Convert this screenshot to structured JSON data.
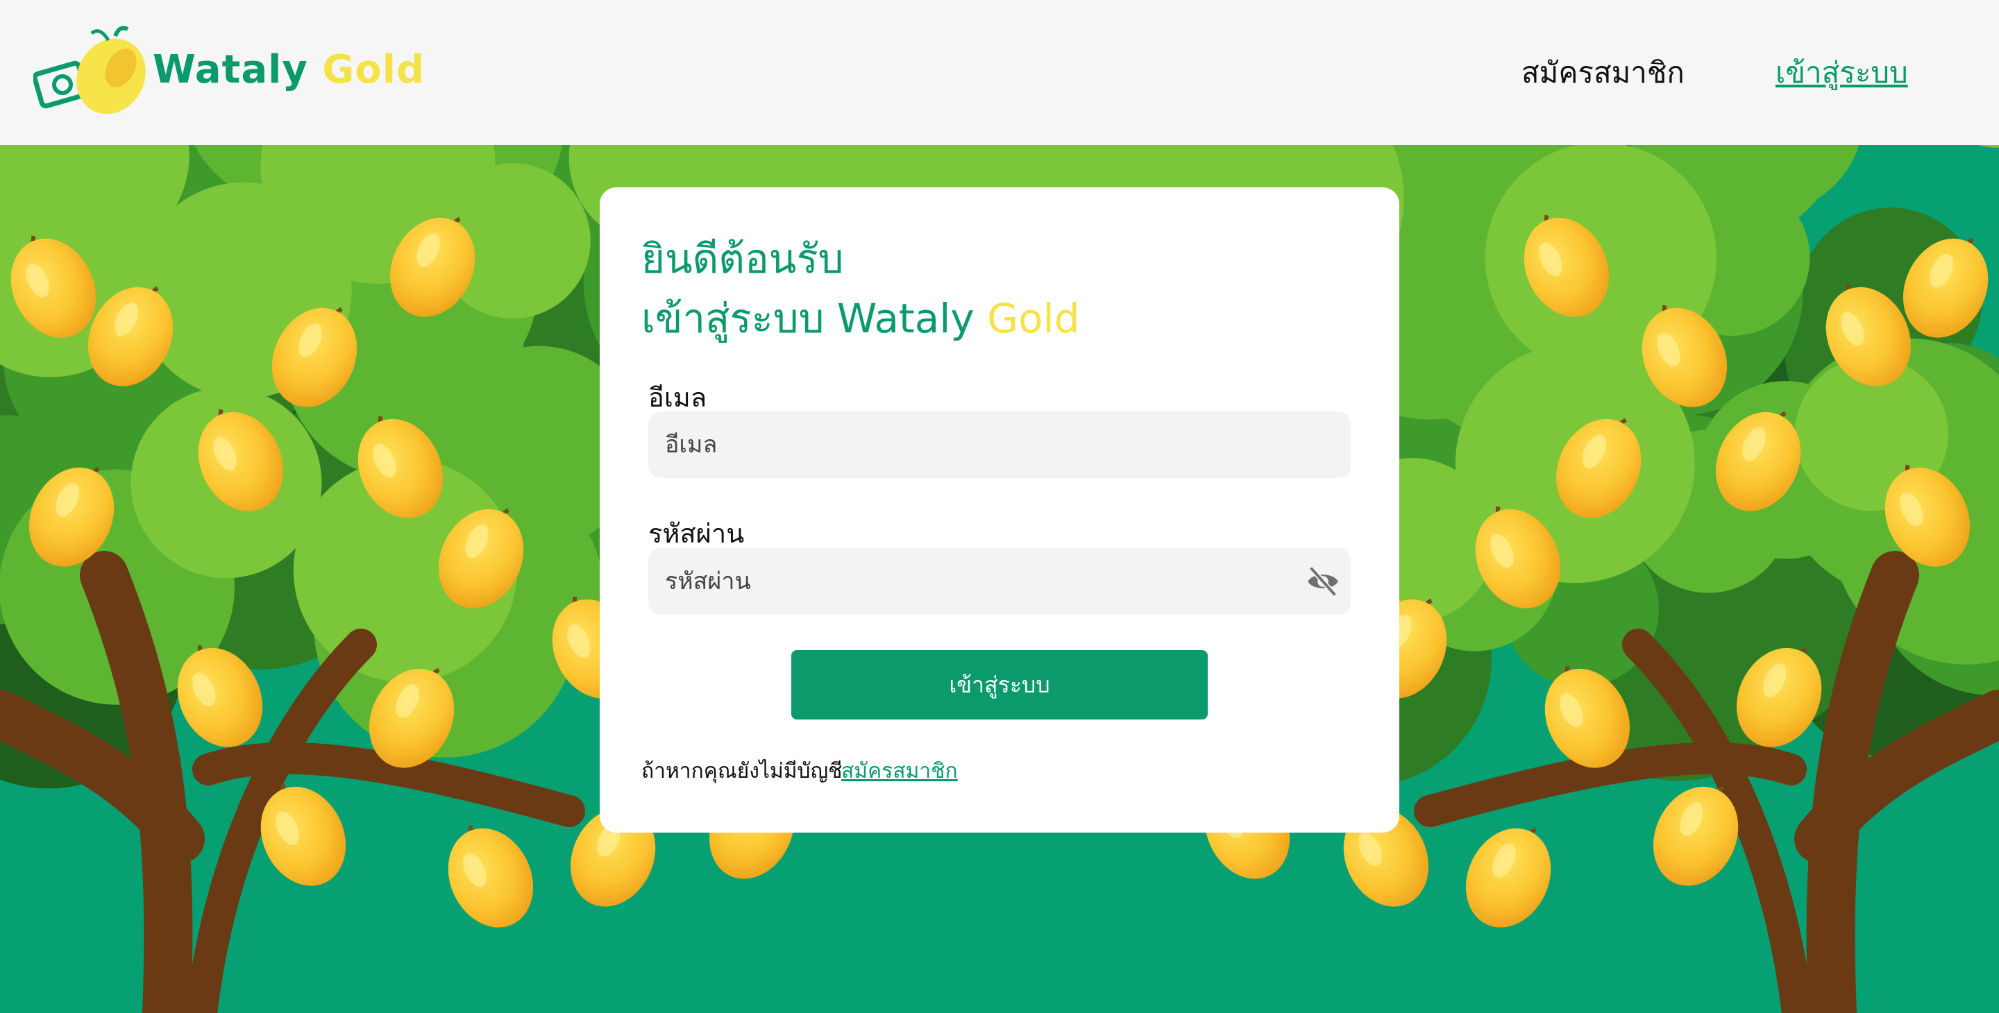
{
  "nav": {
    "logo_word1": "Wataly",
    "logo_word2": "Gold",
    "signup_label": "สมัครสมาชิก",
    "login_label": "เข้าสู่ระบบ"
  },
  "card": {
    "welcome_line1": "ยินดีต้อนรับ",
    "welcome_line2_prefix": "เข้าสู่ระบบ Wataly",
    "welcome_line2_gold": "Gold",
    "email_label": "อีเมล",
    "email_placeholder": "อีเมล",
    "password_label": "รหัสผ่าน",
    "password_placeholder": "รหัสผ่าน",
    "submit_label": "เข้าสู่ระบบ",
    "no_account_text": "ถ้าหากคุณยังไม่มีบัญชี",
    "signup_link": "สมัครสมาชิก"
  },
  "colors": {
    "brand_green": "#0a9a6c",
    "brand_gold": "#f5e24a",
    "background_teal": "#06a073"
  },
  "icons": {
    "logo": "mango-camera-icon",
    "password_toggle": "eye-off-icon"
  }
}
